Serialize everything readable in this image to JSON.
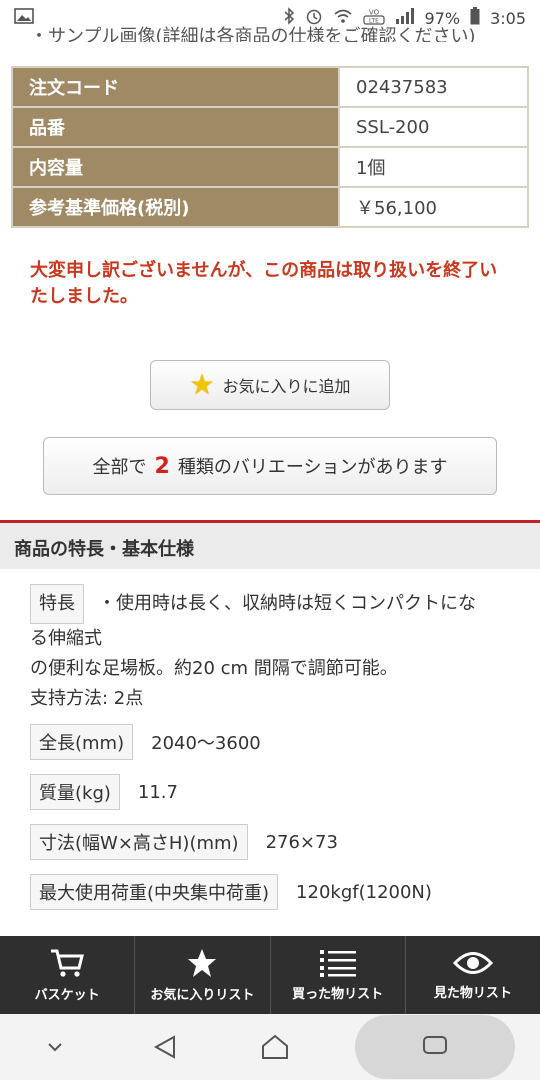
{
  "status_bar": {
    "battery": "97%",
    "time": "3:05"
  },
  "cut_text": "・サンプル画像(詳細は各商品の仕様をご確認ください)",
  "spec_table": [
    {
      "label": "注文コード",
      "value": "02437583"
    },
    {
      "label": "品番",
      "value": "SSL-200"
    },
    {
      "label": "内容量",
      "value": "1個"
    },
    {
      "label": "参考基準価格(税別)",
      "value": "￥56,100"
    }
  ],
  "notice": "大変申し訳ございませんが、この商品は取り扱いを終了いたしました。",
  "favorite_button": "お気に入りに追加",
  "variation": {
    "prefix": "全部で",
    "count": "2",
    "suffix": "種類のバリエーションがあります"
  },
  "section_title": "商品の特長・基本仕様",
  "feature": {
    "tag": "特長",
    "line1": "・使用時は長く、収納時は短くコンパクトにな",
    "line2": "る伸縮式",
    "line3": "の便利な足場板。約20 cm 間隔で調節可能。",
    "line4": "支持方法: 2点"
  },
  "specs": [
    {
      "label": "全長(mm)",
      "value": "2040〜3600"
    },
    {
      "label": "質量(kg)",
      "value": "11.7"
    },
    {
      "label": "寸法(幅W×高さH)(mm)",
      "value": "276×73"
    },
    {
      "label": "最大使用荷重(中央集中荷重)",
      "value": "120kgf(1200N)"
    }
  ],
  "bottom_nav": [
    {
      "label": "バスケット",
      "icon": "cart-icon"
    },
    {
      "label": "お気に入りリスト",
      "icon": "star-icon"
    },
    {
      "label": "買った物リスト",
      "icon": "list-icon"
    },
    {
      "label": "見た物リスト",
      "icon": "eye-icon"
    }
  ]
}
